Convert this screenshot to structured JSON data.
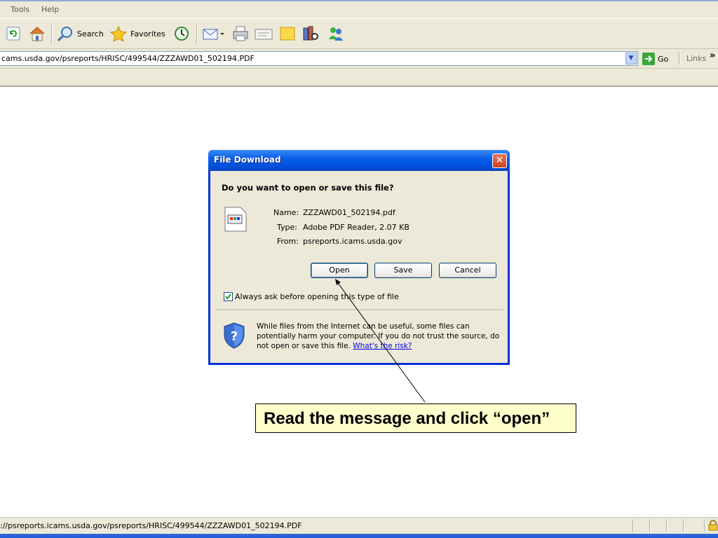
{
  "menu": {
    "tools": "Tools",
    "help": "Help"
  },
  "toolbar": {
    "search_label": "Search",
    "favorites_label": "Favorites"
  },
  "address": {
    "url": "cams.usda.gov/psreports/HRISC/499544/ZZZAWD01_502194.PDF",
    "go_label": "Go",
    "links_label": "Links",
    "chevron": "»"
  },
  "dialog": {
    "title": "File Download",
    "close_glyph": "✕",
    "question": "Do you want to open or save this file?",
    "name_label": "Name:",
    "name_value": "ZZZAWD01_502194.pdf",
    "type_label": "Type:",
    "type_value": "Adobe PDF Reader, 2.07 KB",
    "from_label": "From:",
    "from_value": "psreports.icams.usda.gov",
    "open_label": "Open",
    "save_label": "Save",
    "cancel_label": "Cancel",
    "always_ask_label": "Always ask before opening this type of file",
    "always_ask_checked": true,
    "warning_text": "While files from the Internet can be useful, some files can potentially harm your computer. If you do not trust the source, do not open or save this file.",
    "risk_link": "What's the risk?"
  },
  "callout": {
    "text": "Read the message and click “open”"
  },
  "status": {
    "text": "://psreports.icams.usda.gov/psreports/HRISC/499544/ZZZAWD01_502194.PDF"
  },
  "colors": {
    "xp_blue": "#0054e3",
    "chrome": "#ece9d8",
    "callout_bg": "#ffffcc",
    "link": "#0000ee"
  }
}
